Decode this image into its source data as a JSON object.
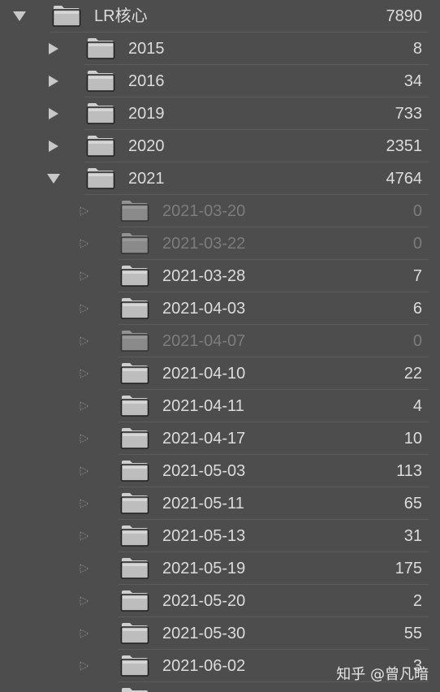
{
  "root": {
    "label": "LR核心",
    "count": "7890",
    "expanded": true
  },
  "years": [
    {
      "label": "2015",
      "count": "8",
      "expanded": false
    },
    {
      "label": "2016",
      "count": "34",
      "expanded": false
    },
    {
      "label": "2019",
      "count": "733",
      "expanded": false
    },
    {
      "label": "2020",
      "count": "2351",
      "expanded": false
    },
    {
      "label": "2021",
      "count": "4764",
      "expanded": true
    }
  ],
  "dates": [
    {
      "label": "2021-03-20",
      "count": "0"
    },
    {
      "label": "2021-03-22",
      "count": "0"
    },
    {
      "label": "2021-03-28",
      "count": "7"
    },
    {
      "label": "2021-04-03",
      "count": "6"
    },
    {
      "label": "2021-04-07",
      "count": "0"
    },
    {
      "label": "2021-04-10",
      "count": "22"
    },
    {
      "label": "2021-04-11",
      "count": "4"
    },
    {
      "label": "2021-04-17",
      "count": "10"
    },
    {
      "label": "2021-05-03",
      "count": "113"
    },
    {
      "label": "2021-05-11",
      "count": "65"
    },
    {
      "label": "2021-05-13",
      "count": "31"
    },
    {
      "label": "2021-05-19",
      "count": "175"
    },
    {
      "label": "2021-05-20",
      "count": "2"
    },
    {
      "label": "2021-05-30",
      "count": "55"
    },
    {
      "label": "2021-06-02",
      "count": "3"
    }
  ],
  "watermark": "知乎 @曾凡暗",
  "colors": {
    "background": "#4d4d4d",
    "text": "#dcdcdc",
    "text_dim": "#7c7c7c",
    "folder": "#c4c4c4"
  },
  "icons": {
    "collapsed": "triangle-right-icon",
    "expanded": "triangle-down-icon",
    "leaf": "dotted-triangle-icon",
    "folder": "folder-icon"
  }
}
